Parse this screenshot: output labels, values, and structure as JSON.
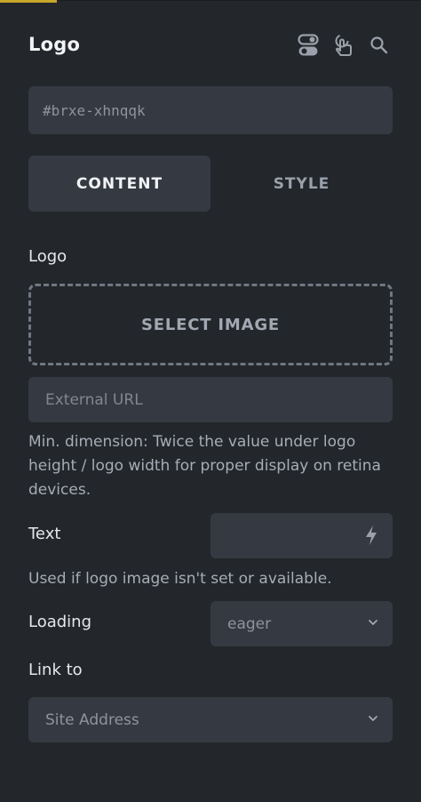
{
  "panel": {
    "title": "Logo"
  },
  "header_icons": [
    {
      "name": "toggle-icon"
    },
    {
      "name": "pointer-hand-icon"
    },
    {
      "name": "search-icon"
    }
  ],
  "element_id": {
    "value": "#brxe-xhnqqk"
  },
  "tabs": [
    {
      "label": "CONTENT",
      "active": true
    },
    {
      "label": "STYLE",
      "active": false
    }
  ],
  "logo": {
    "label": "Logo",
    "select_image_label": "SELECT IMAGE",
    "external_url_placeholder": "External URL",
    "hint": "Min. dimension: Twice the value under logo height / logo width for proper display on retina devices."
  },
  "text": {
    "label": "Text",
    "value": "",
    "hint": "Used if logo image isn't set or available."
  },
  "loading": {
    "label": "Loading",
    "selected": "eager"
  },
  "link_to": {
    "label": "Link to",
    "selected": "Site Address"
  },
  "colors": {
    "background": "#23262b",
    "field": "#353a42",
    "accent": "#c8a62a"
  }
}
